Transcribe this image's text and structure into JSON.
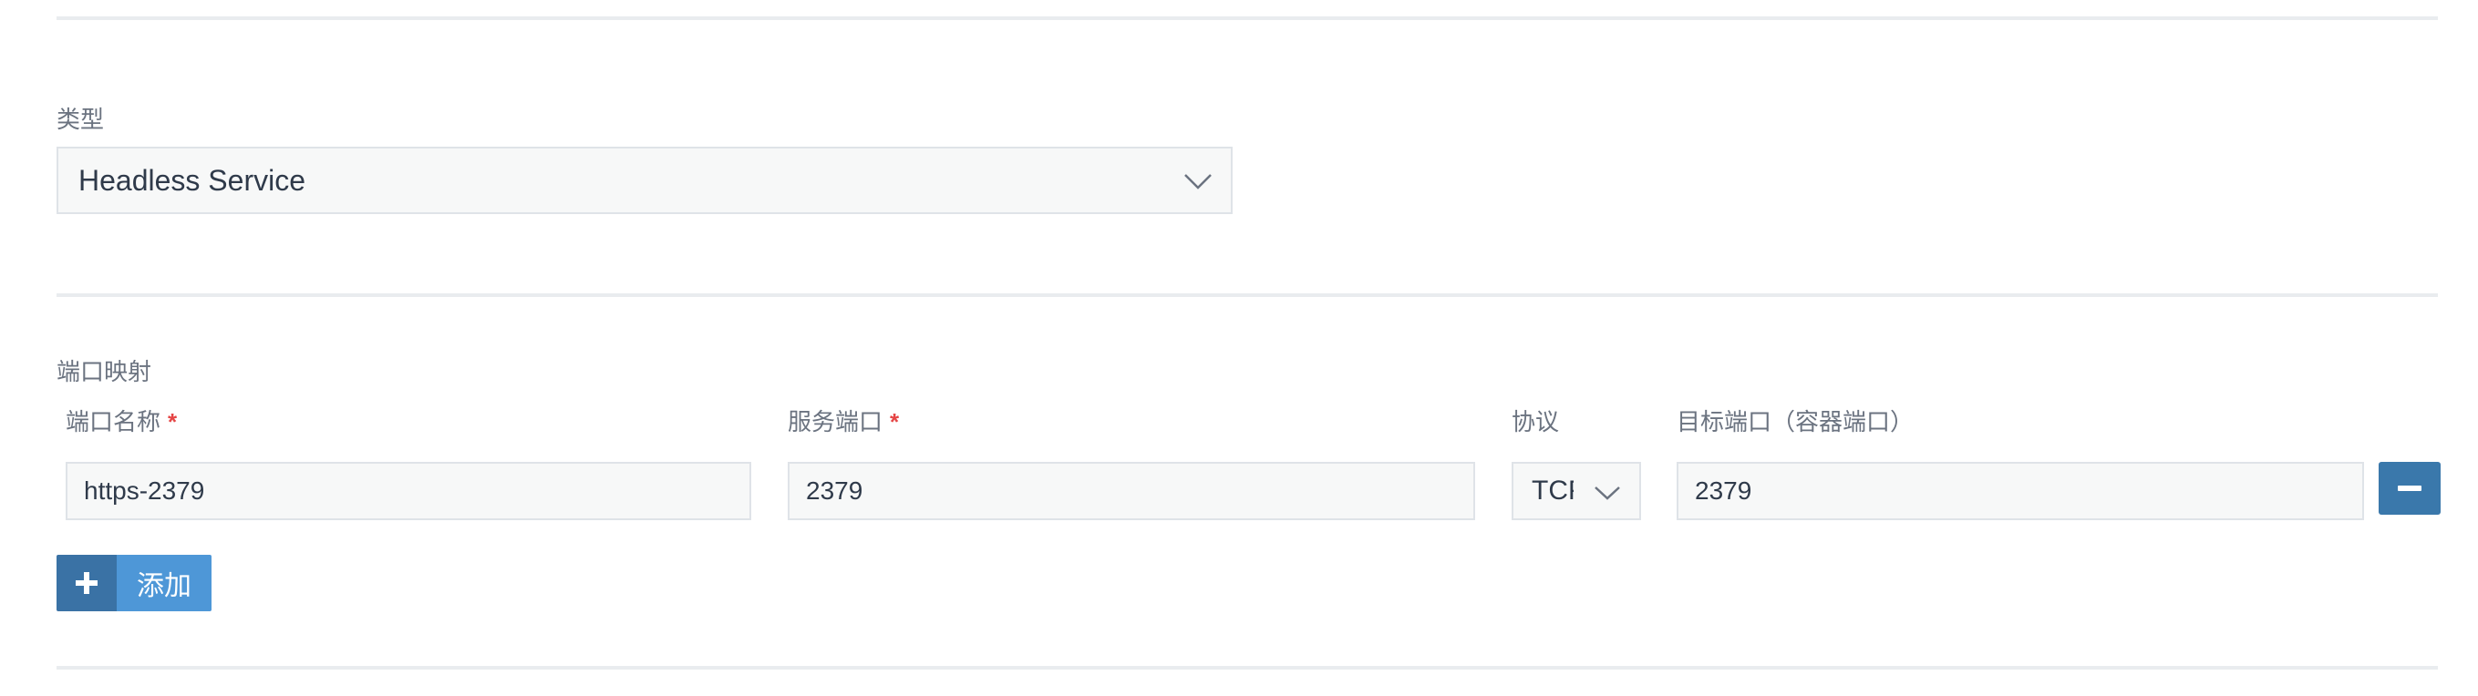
{
  "type_section": {
    "label": "类型",
    "selected": "Headless Service"
  },
  "ports_section": {
    "label": "端口映射",
    "columns": {
      "port_name": "端口名称",
      "service_port": "服务端口",
      "protocol": "协议",
      "target_port": "目标端口（容器端口）"
    },
    "required_mark": "*",
    "rows": [
      {
        "port_name": "https-2379",
        "service_port": "2379",
        "protocol": "TCP",
        "target_port": "2379"
      }
    ],
    "add_label": "添加"
  },
  "icons": {
    "select_chevron": "chevron-down-icon",
    "remove": "minus-icon",
    "add": "plus-icon"
  },
  "colors": {
    "primary": "#4e97d7",
    "primary_dark": "#3a72a5",
    "required": "#e54545"
  }
}
